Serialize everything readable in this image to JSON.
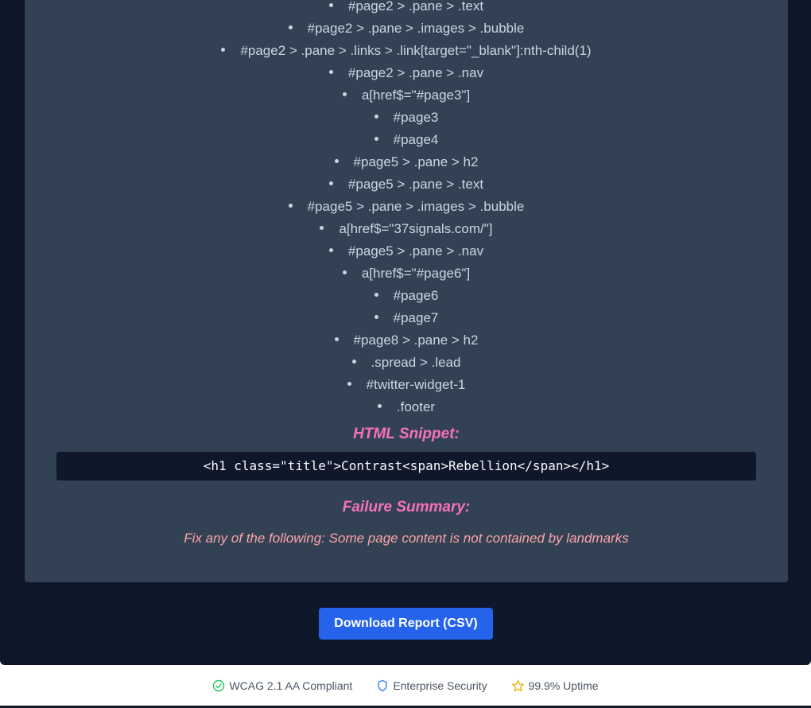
{
  "selectors": [
    "#page2 > .pane > .text",
    "#page2 > .pane > .images > .bubble",
    "#page2 > .pane > .links > .link[target=\"_blank\"]:nth-child(1)",
    "#page2 > .pane > .nav",
    "a[href$=\"#page3\"]",
    "#page3",
    "#page4",
    "#page5 > .pane > h2",
    "#page5 > .pane > .text",
    "#page5 > .pane > .images > .bubble",
    "a[href$=\"37signals.com/\"]",
    "#page5 > .pane > .nav",
    "a[href$=\"#page6\"]",
    "#page6",
    "#page7",
    "#page8 > .pane > h2",
    ".spread > .lead",
    "#twitter-widget-1",
    ".footer"
  ],
  "snippet": {
    "heading": "HTML Snippet:",
    "code": "<h1 class=\"title\">Contrast<span>Rebellion</span></h1>"
  },
  "failure": {
    "heading": "Failure Summary:",
    "text": "Fix any of the following: Some page content is not contained by landmarks"
  },
  "actions": {
    "download_label": "Download Report (CSV)"
  },
  "footer": {
    "badges": [
      {
        "label": "WCAG 2.1 AA Compliant",
        "icon": "check-circle-icon",
        "color": "#22c55e"
      },
      {
        "label": "Enterprise Security",
        "icon": "shield-icon",
        "color": "#3b82f6"
      },
      {
        "label": "99.9% Uptime",
        "icon": "star-icon",
        "color": "#eab308"
      }
    ]
  },
  "colors": {
    "background": "#0f172a",
    "panel": "#334155",
    "heading_accent": "#f472b6",
    "failure_text": "#fca5a5",
    "button": "#2563eb"
  }
}
